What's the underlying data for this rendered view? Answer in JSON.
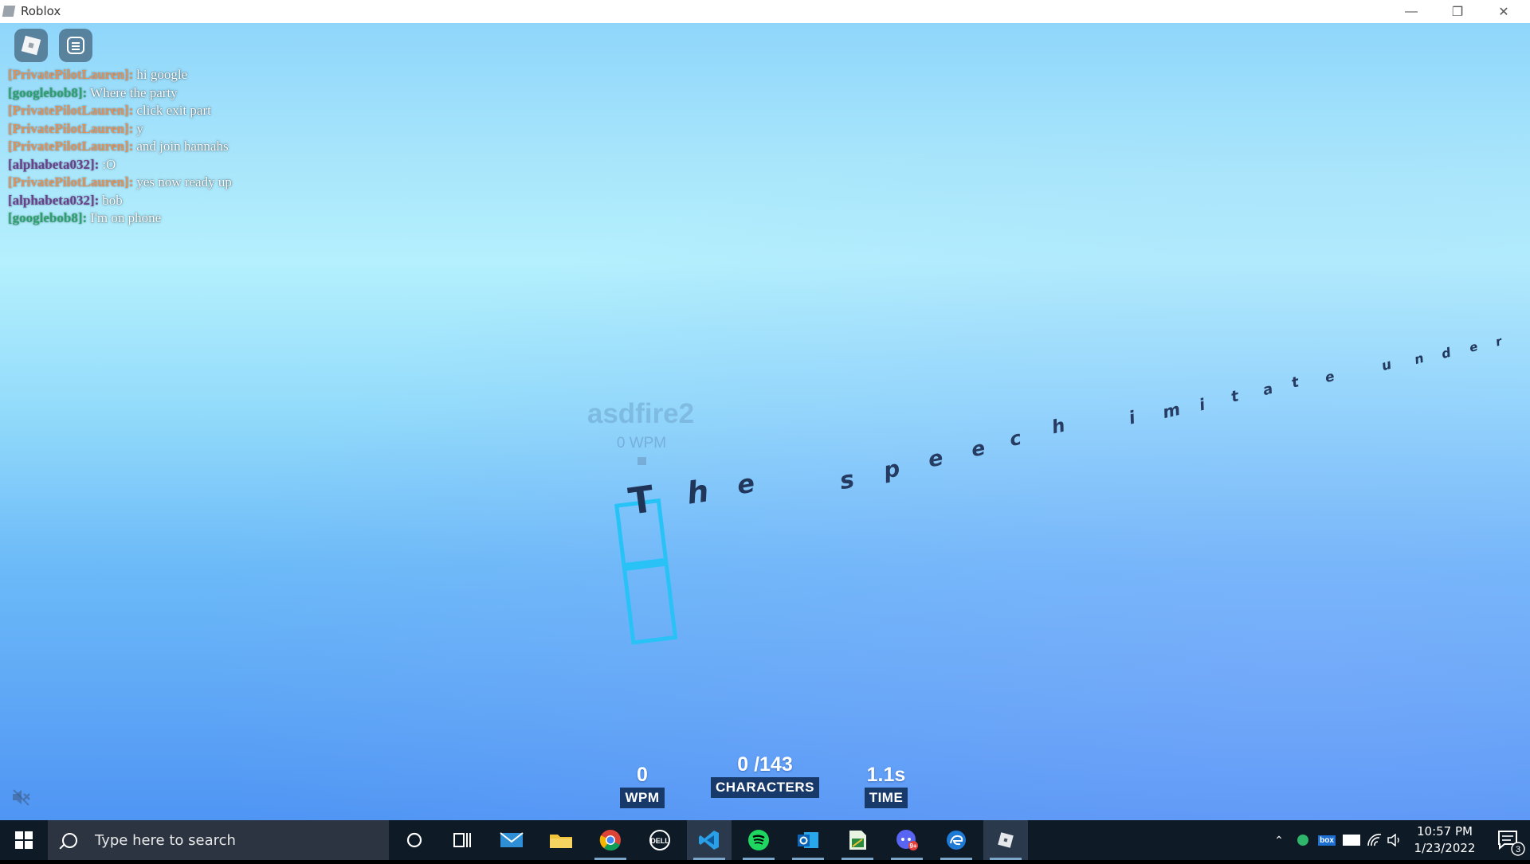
{
  "window": {
    "title": "Roblox"
  },
  "chat": {
    "messages": [
      {
        "name": "[PrivatePilotLauren]:",
        "text": "hi google",
        "color": "#e0915a"
      },
      {
        "name": "[googlebob8]:",
        "text": "Where the party",
        "color": "#27a36b"
      },
      {
        "name": "[PrivatePilotLauren]:",
        "text": "click exit part",
        "color": "#e0915a"
      },
      {
        "name": "[PrivatePilotLauren]:",
        "text": "y",
        "color": "#e0915a"
      },
      {
        "name": "[PrivatePilotLauren]:",
        "text": "and join hannahs",
        "color": "#e0915a"
      },
      {
        "name": "[alphabeta032]:",
        "text": ":O",
        "color": "#6b3f8f"
      },
      {
        "name": "[PrivatePilotLauren]:",
        "text": "yes now ready up",
        "color": "#e0915a"
      },
      {
        "name": "[alphabeta032]:",
        "text": "bob",
        "color": "#6b3f8f"
      },
      {
        "name": "[googlebob8]:",
        "text": "I'm on phone",
        "color": "#27a36b"
      }
    ]
  },
  "player": {
    "name": "asdfire2",
    "wpm": "0 WPM"
  },
  "sentence": {
    "words": [
      "The",
      "speech",
      "imitate",
      "under"
    ]
  },
  "stats": {
    "wpm": {
      "value": "0",
      "label": "WPM"
    },
    "characters": {
      "value": "0 /143",
      "label": "CHARACTERS"
    },
    "time": {
      "value": "1.1s",
      "label": "TIME"
    }
  },
  "taskbar": {
    "search_placeholder": "Type here to search",
    "apps": [
      "cortana-icon",
      "task-view-icon",
      "mail-icon",
      "file-explorer-icon",
      "chrome-icon",
      "dell-icon",
      "vscode-icon",
      "spotify-icon",
      "outlook-icon",
      "spreadsheet-icon",
      "discord-icon",
      "edge-dev-icon",
      "roblox-icon"
    ],
    "time": "10:57 PM",
    "date": "1/23/2022",
    "notifications": "3"
  }
}
